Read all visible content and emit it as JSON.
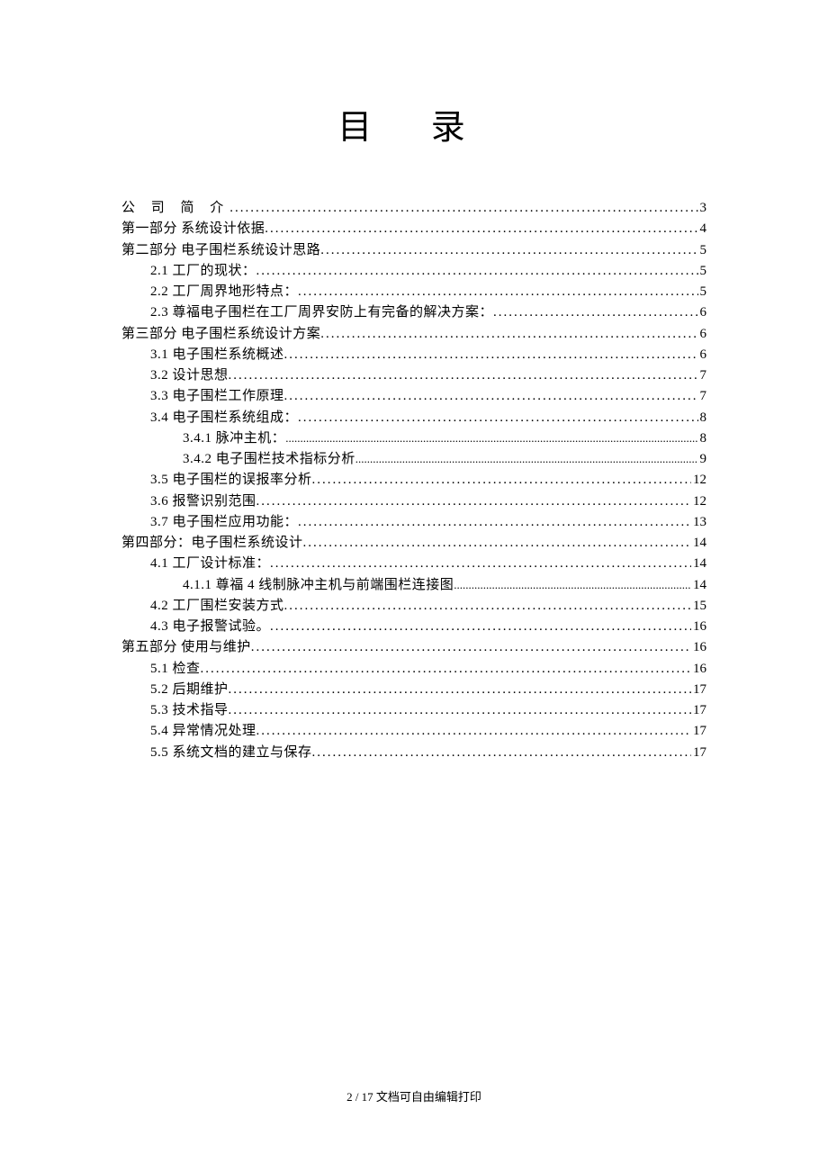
{
  "title": "目 录",
  "footer": "2 / 17 文档可自由编辑打印",
  "toc": [
    {
      "label": "公 司 简 介",
      "page": "3",
      "level": 0,
      "spaced": true,
      "fine": false
    },
    {
      "label": "第一部分 系统设计依据",
      "page": "4",
      "level": 0,
      "spaced": false,
      "fine": false
    },
    {
      "label": "第二部分 电子围栏系统设计思路",
      "page": "5",
      "level": 0,
      "spaced": false,
      "fine": false
    },
    {
      "label": "2.1 工厂的现状：",
      "page": "5",
      "level": 1,
      "spaced": false,
      "fine": false
    },
    {
      "label": "2.2 工厂周界地形特点：",
      "page": "5",
      "level": 1,
      "spaced": false,
      "fine": false
    },
    {
      "label": "2.3 尊福电子围栏在工厂周界安防上有完备的解决方案：",
      "page": "6",
      "level": 1,
      "spaced": false,
      "fine": false
    },
    {
      "label": "第三部分 电子围栏系统设计方案",
      "page": "6",
      "level": 0,
      "spaced": false,
      "fine": false
    },
    {
      "label": "3.1 电子围栏系统概述",
      "page": "6",
      "level": 1,
      "spaced": false,
      "fine": false
    },
    {
      "label": "3.2 设计思想",
      "page": "7",
      "level": 1,
      "spaced": false,
      "fine": false
    },
    {
      "label": "3.3 电子围栏工作原理",
      "page": "7",
      "level": 1,
      "spaced": false,
      "fine": false
    },
    {
      "label": "3.4 电子围栏系统组成：",
      "page": "8",
      "level": 1,
      "spaced": false,
      "fine": false
    },
    {
      "label": "3.4.1 脉冲主机：",
      "page": "8",
      "level": 2,
      "spaced": false,
      "fine": true
    },
    {
      "label": "3.4.2 电子围栏技术指标分析",
      "page": "9",
      "level": 2,
      "spaced": false,
      "fine": true
    },
    {
      "label": "3.5 电子围栏的误报率分析",
      "page": "12",
      "level": 1,
      "spaced": false,
      "fine": false
    },
    {
      "label": "3.6 报警识别范围",
      "page": "12",
      "level": 1,
      "spaced": false,
      "fine": false
    },
    {
      "label": "3.7 电子围栏应用功能：",
      "page": "13",
      "level": 1,
      "spaced": false,
      "fine": false
    },
    {
      "label": "第四部分：电子围栏系统设计",
      "page": "14",
      "level": 0,
      "spaced": false,
      "fine": false
    },
    {
      "label": "4.1 工厂设计标准：",
      "page": "14",
      "level": 1,
      "spaced": false,
      "fine": false
    },
    {
      "label": "4.1.1 尊福 4 线制脉冲主机与前端围栏连接图",
      "page": "14",
      "level": 2,
      "spaced": false,
      "fine": true
    },
    {
      "label": "4.2 工厂围栏安装方式",
      "page": "15",
      "level": 1,
      "spaced": false,
      "fine": false
    },
    {
      "label": "4.3 电子报警试验。",
      "page": "16",
      "level": 1,
      "spaced": false,
      "fine": false
    },
    {
      "label": "第五部分 使用与维护",
      "page": "16",
      "level": 0,
      "spaced": false,
      "fine": false
    },
    {
      "label": "5.1 检查",
      "page": "16",
      "level": 1,
      "spaced": false,
      "fine": false
    },
    {
      "label": "5.2 后期维护",
      "page": "17",
      "level": 1,
      "spaced": false,
      "fine": false
    },
    {
      "label": "5.3 技术指导",
      "page": "17",
      "level": 1,
      "spaced": false,
      "fine": false
    },
    {
      "label": "5.4 异常情况处理",
      "page": "17",
      "level": 1,
      "spaced": false,
      "fine": false
    },
    {
      "label": "5.5 系统文档的建立与保存",
      "page": "17",
      "level": 1,
      "spaced": false,
      "fine": false
    }
  ]
}
